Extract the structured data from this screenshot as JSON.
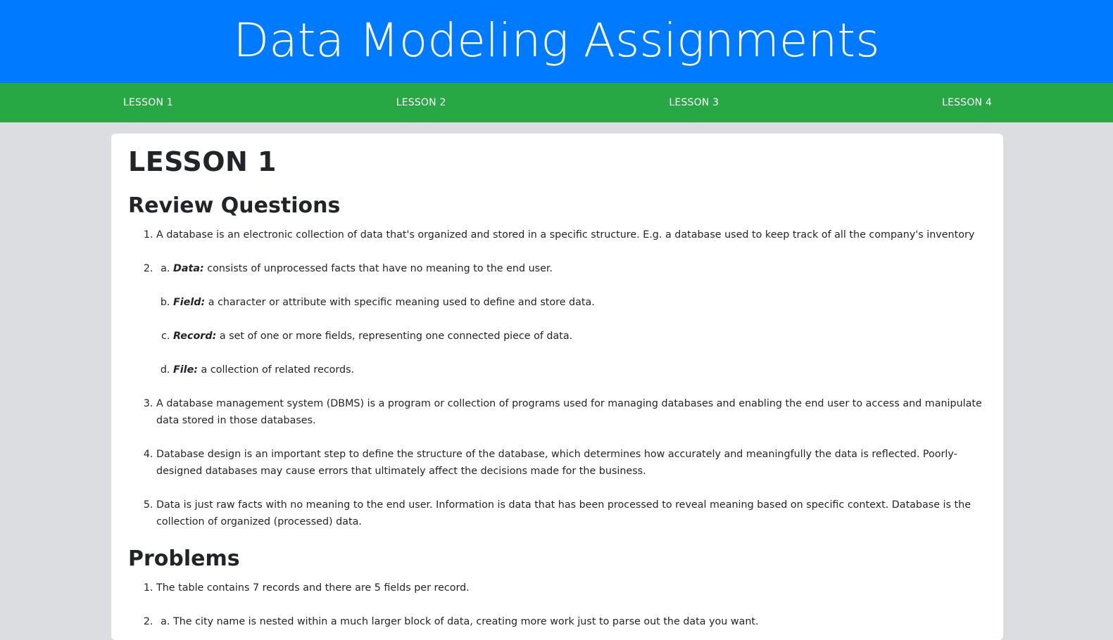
{
  "header": {
    "title": "Data Modeling Assignments"
  },
  "nav": {
    "items": [
      {
        "label": "LESSON 1"
      },
      {
        "label": "LESSON 2"
      },
      {
        "label": "LESSON 3"
      },
      {
        "label": "LESSON 4"
      }
    ]
  },
  "content": {
    "lesson_title": "LESSON 1",
    "review_heading": "Review Questions",
    "review": {
      "q1": "A database is an electronic collection of data that's organized and stored in a specific structure. E.g. a database used to keep track of all the company's inventory",
      "q2": {
        "a_term": "Data:",
        "a_text": " consists of unprocessed facts that have no meaning to the end user.",
        "b_term": "Field:",
        "b_text": " a character or attribute with specific meaning used to define and store data.",
        "c_term": "Record:",
        "c_text": " a set of one or more fields, representing one connected piece of data.",
        "d_term": "File:",
        "d_text": " a collection of related records."
      },
      "q3": "A database management system (DBMS) is a program or collection of programs used for managing databases and enabling the end user to access and manipulate data stored in those databases.",
      "q4": "Database design is an important step to define the structure of the database, which determines how accurately and meaningfully the data is reflected. Poorly-designed databases may cause errors that ultimately affect the decisions made for the business.",
      "q5": "Data is just raw facts with no meaning to the end user. Information is data that has been processed to reveal meaning based on specific context. Database is the collection of organized (processed) data."
    },
    "problems_heading": "Problems",
    "problems": {
      "p1": "The table contains 7 records and there are 5 fields per record.",
      "p2a": "The city name is nested within a much larger block of data, creating more work just to parse out the data you want."
    }
  }
}
